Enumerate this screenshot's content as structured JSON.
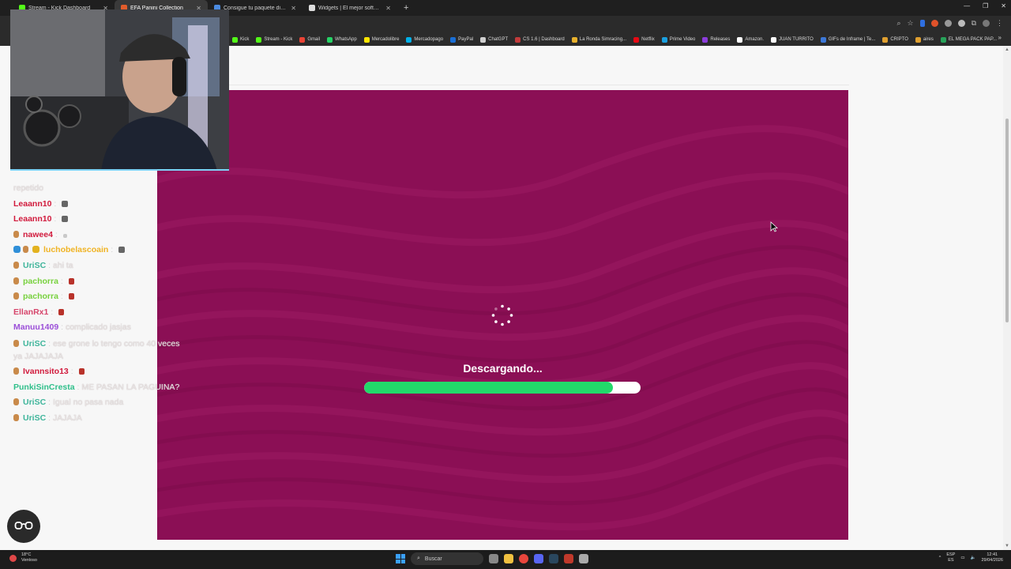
{
  "browser": {
    "tabs": [
      {
        "title": "Stream - Kick Dashboard",
        "icon": "kick-icon",
        "color": "#53fc18",
        "active": false
      },
      {
        "title": "EFA Panini Collection",
        "icon": "panini-icon",
        "color": "#e25c2b",
        "active": true
      },
      {
        "title": "Consigue tu paquete diario gratis",
        "icon": "panini-icon",
        "color": "#4b8be0",
        "active": false
      },
      {
        "title": "Widgets | El mejor software para",
        "icon": "widget-icon",
        "color": "#dddddd",
        "active": false
      }
    ],
    "new_tab": "+",
    "bookmarks": [
      {
        "label": "Kick",
        "color": "#53fc18"
      },
      {
        "label": "Stream - Kick",
        "color": "#53fc18"
      },
      {
        "label": "Gmail",
        "color": "#ea4335"
      },
      {
        "label": "WhatsApp",
        "color": "#25d366"
      },
      {
        "label": "Mercadolibre",
        "color": "#ffe600"
      },
      {
        "label": "Mercadopago",
        "color": "#00b1ea"
      },
      {
        "label": "PayPal",
        "color": "#1a6fd6"
      },
      {
        "label": "ChatGPT",
        "color": "#d0d0d0"
      },
      {
        "label": "CS 1.6 | Dashboard",
        "color": "#c23b3b"
      },
      {
        "label": "La Ronda Simracing...",
        "color": "#e8b12c"
      },
      {
        "label": "Netflix",
        "color": "#e50914"
      },
      {
        "label": "Prime Video",
        "color": "#1aa0e0"
      },
      {
        "label": "Releases",
        "color": "#8c3cdc"
      },
      {
        "label": "Amazon.",
        "color": "#ffffff"
      },
      {
        "label": "JUAN TURRITO",
        "color": "#ffffff"
      },
      {
        "label": "GIFs de Inframe | Te...",
        "color": "#3c78d8"
      },
      {
        "label": "CRIPTO",
        "color": "#e0a030"
      },
      {
        "label": "aires",
        "color": "#e0a030"
      },
      {
        "label": "EL MEGA PACK PAP...",
        "color": "#27a35a"
      }
    ],
    "bookmarks_more": "»"
  },
  "loader": {
    "status_text": "Descargando...",
    "progress": 0.9,
    "background_color": "#8b0f55",
    "progress_color": "#22d96a"
  },
  "chat": {
    "messages": [
      {
        "user": "",
        "text": "repetido",
        "color": "#ffffff",
        "badges": [],
        "emote": ""
      },
      {
        "user": "Leaann10",
        "text": "",
        "color": "#d11a3c",
        "badges": [],
        "emote": "dark"
      },
      {
        "user": "Leaann10",
        "text": "",
        "color": "#d11a3c",
        "badges": [],
        "emote": "dark"
      },
      {
        "user": "nawee4",
        "text": "",
        "color": "#d11a3c",
        "badges": [
          "bronze"
        ],
        "emote": "light"
      },
      {
        "user": "luchobelascoain",
        "text": "",
        "color": "#f0b323",
        "badges": [
          "blue",
          "bronze",
          "gold"
        ],
        "emote": "dark"
      },
      {
        "user": "UriSC",
        "text": "ahi ta",
        "color": "#3fb59b",
        "badges": [
          "bronze"
        ],
        "emote": ""
      },
      {
        "user": "pachorra",
        "text": "",
        "color": "#78d13e",
        "badges": [
          "bronze"
        ],
        "emote": "red"
      },
      {
        "user": "pachorra",
        "text": "",
        "color": "#78d13e",
        "badges": [
          "bronze"
        ],
        "emote": "red"
      },
      {
        "user": "EllanRx1",
        "text": "",
        "color": "#d6456b",
        "badges": [],
        "emote": "red"
      },
      {
        "user": "Manuu1409",
        "text": "complicado jasjas",
        "color": "#9b4fd8",
        "badges": [],
        "emote": ""
      },
      {
        "user": "UriSC",
        "text": "ese grone lo tengo como 40 veces ya JAJAJAJA",
        "color": "#3fb59b",
        "badges": [
          "bronze"
        ],
        "emote": ""
      },
      {
        "user": "Ivannsito13",
        "text": "",
        "color": "#d11a3c",
        "badges": [
          "bronze"
        ],
        "emote": "red"
      },
      {
        "user": "PunkiSinCresta",
        "text": "ME PASAN LA PAGUINA?",
        "color": "#2fbf8a",
        "badges": [],
        "emote": ""
      },
      {
        "user": "UriSC",
        "text": "Igual no pasa nada",
        "color": "#3fb59b",
        "badges": [
          "bronze"
        ],
        "emote": ""
      },
      {
        "user": "UriSC",
        "text": "JAJAJA",
        "color": "#3fb59b",
        "badges": [
          "bronze"
        ],
        "emote": ""
      }
    ]
  },
  "taskbar": {
    "weather_temp": "18°C",
    "weather_desc": "Ventoso",
    "search_placeholder": "Buscar",
    "language": "ESP",
    "language_sub": "ES",
    "time": "12:41",
    "date": "29/04/2026"
  }
}
